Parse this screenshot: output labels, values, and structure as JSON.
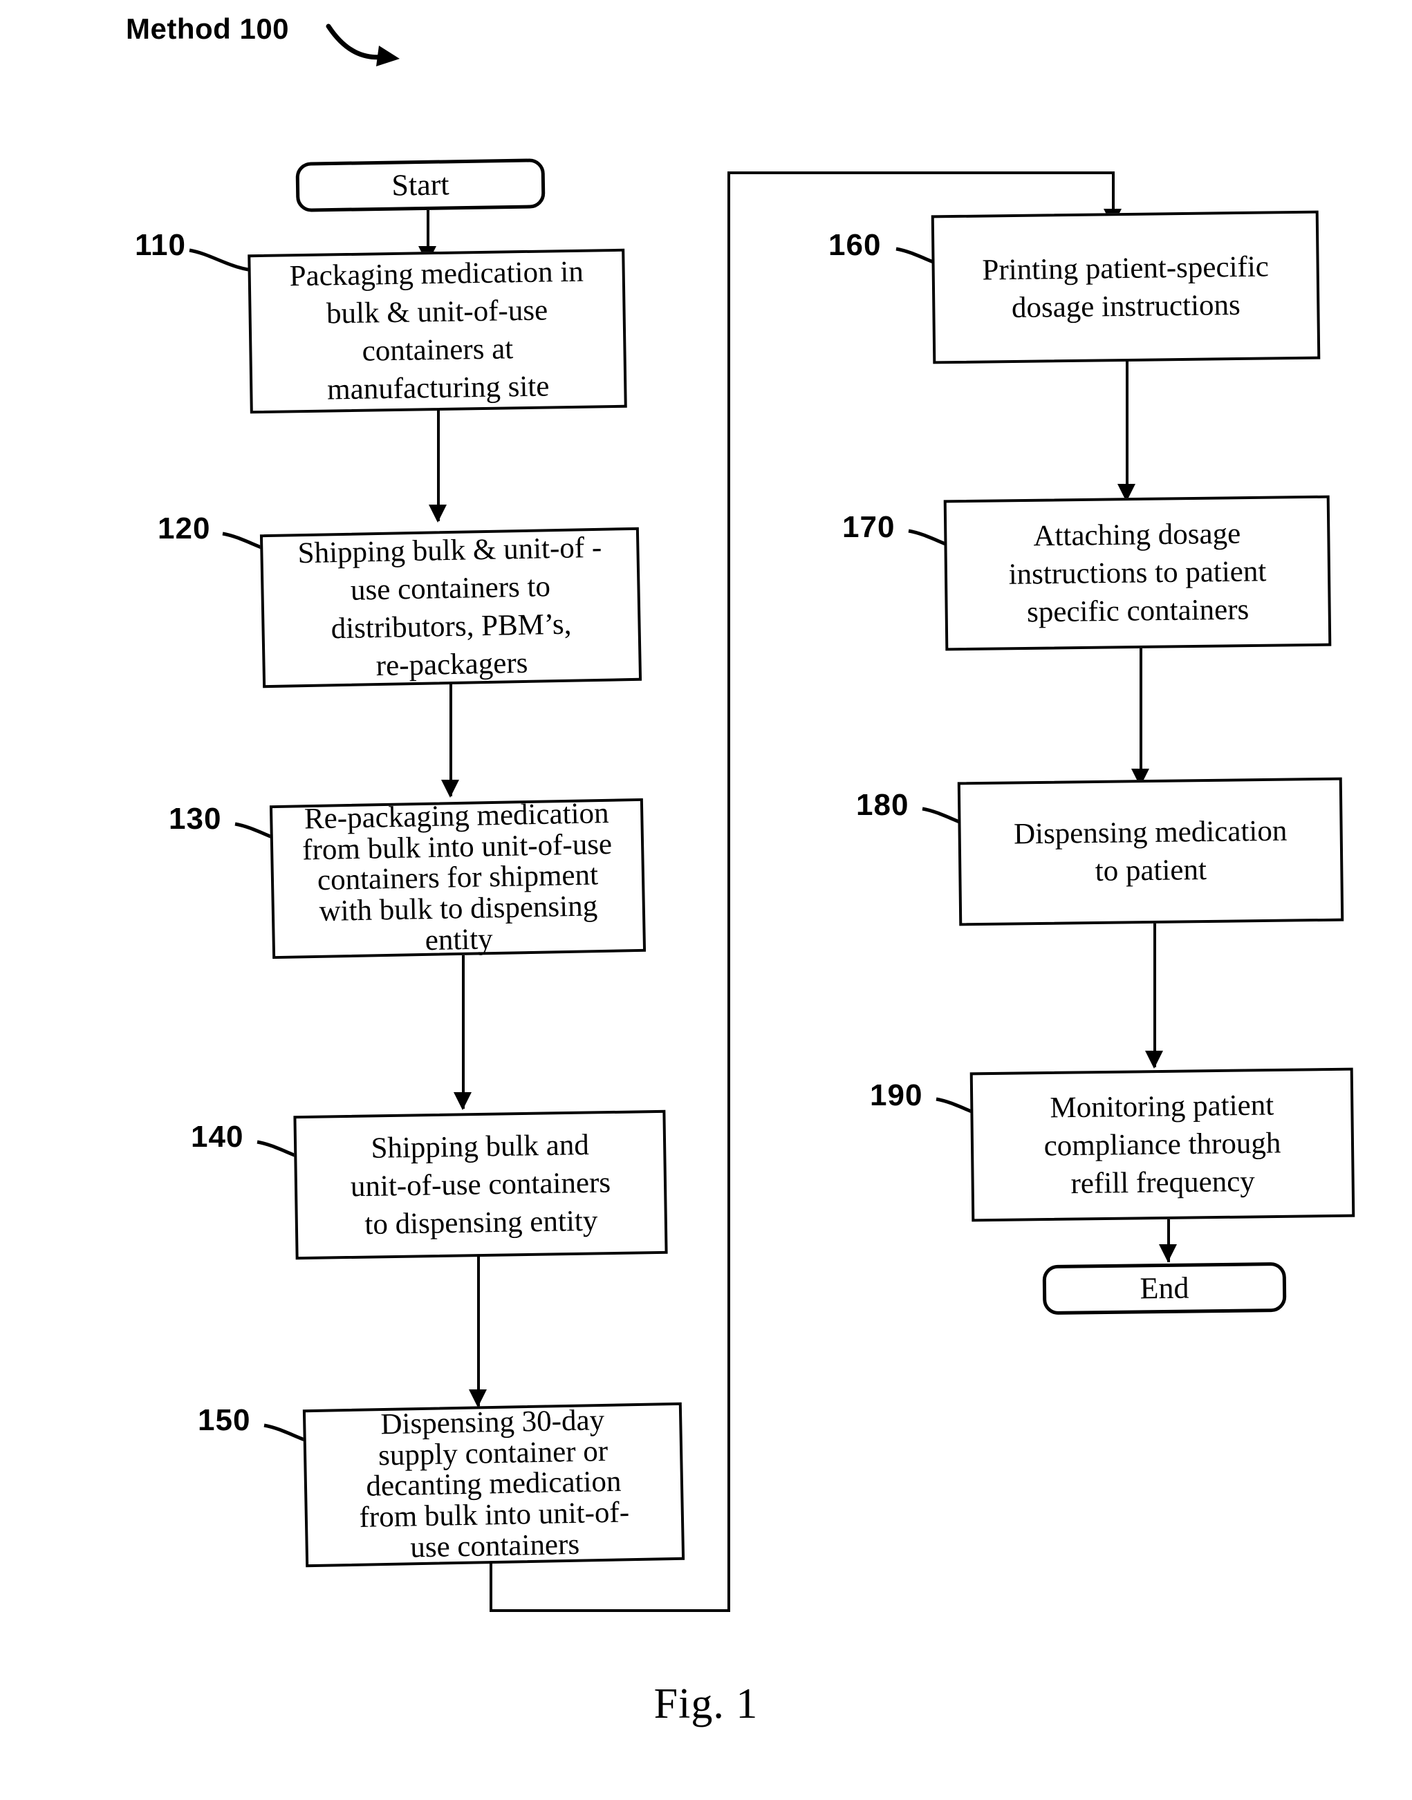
{
  "figure": {
    "title": "Method 100",
    "caption": "Fig. 1"
  },
  "terminators": {
    "start": "Start",
    "end": "End"
  },
  "steps": [
    {
      "ref": "110",
      "text": "Packaging medication in\nbulk & unit-of-use\ncontainers at\nmanufacturing site"
    },
    {
      "ref": "120",
      "text": "Shipping bulk & unit-of -\nuse containers to\ndistributors, PBM’s,\nre-packagers"
    },
    {
      "ref": "130",
      "text": "Re-packaging medication\nfrom bulk into unit-of-use\ncontainers for shipment\nwith bulk to dispensing\nentity"
    },
    {
      "ref": "140",
      "text": "Shipping bulk and\nunit-of-use containers\nto dispensing entity"
    },
    {
      "ref": "150",
      "text": "Dispensing 30-day\nsupply container or\ndecanting medication\nfrom bulk into unit-of-\nuse containers"
    },
    {
      "ref": "160",
      "text": "Printing patient-specific\ndosage instructions"
    },
    {
      "ref": "170",
      "text": "Attaching dosage\ninstructions to patient\nspecific containers"
    },
    {
      "ref": "180",
      "text": "Dispensing medication\nto patient"
    },
    {
      "ref": "190",
      "text": "Monitoring patient\ncompliance through\nrefill frequency"
    }
  ],
  "colors": {
    "ink": "#000000",
    "paper": "#ffffff"
  }
}
